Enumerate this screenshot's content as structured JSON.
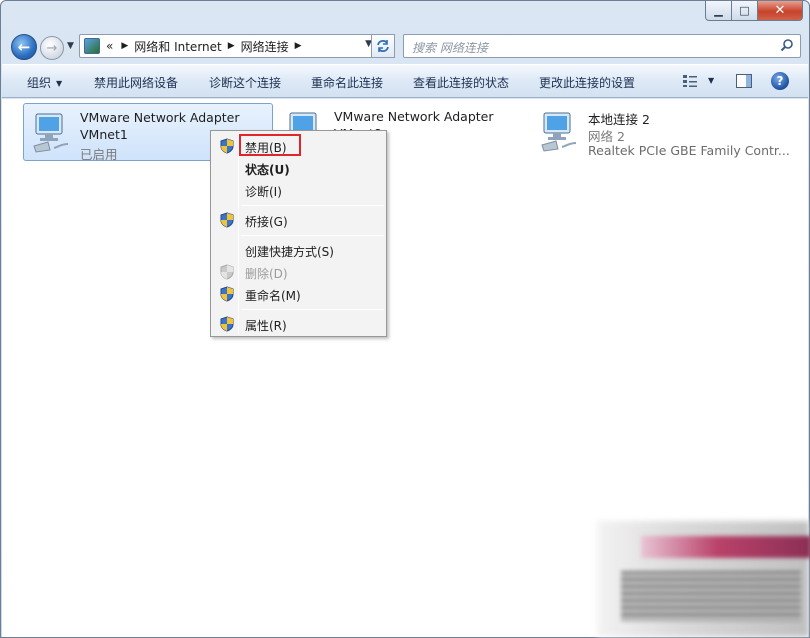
{
  "window": {
    "caption": {
      "minimize": "▁",
      "maximize": "□",
      "close": "✕"
    }
  },
  "navigation": {
    "back_icon": "back-arrow-icon",
    "forward_icon": "forward-arrow-icon",
    "address": {
      "overflow": "«",
      "crumbs": [
        "网络和 Internet",
        "网络连接"
      ]
    },
    "search_placeholder": "搜索 网络连接"
  },
  "command_bar": {
    "items": [
      {
        "label": "组织",
        "has_dropdown": true
      },
      {
        "label": "禁用此网络设备"
      },
      {
        "label": "诊断这个连接"
      },
      {
        "label": "重命名此连接"
      },
      {
        "label": "查看此连接的状态"
      },
      {
        "label": "更改此连接的设置"
      }
    ],
    "help_label": "?"
  },
  "adapters": [
    {
      "name": "VMware Network Adapter",
      "sub": "VMnet1",
      "status": "已启用",
      "selected": true
    },
    {
      "name": "VMware Network Adapter",
      "sub": "VMnet8",
      "status": "",
      "selected": false
    },
    {
      "name": "本地连接 2",
      "sub": "网络  2",
      "status": "Realtek PCIe GBE Family Contr...",
      "selected": false
    }
  ],
  "context_menu": {
    "items": [
      {
        "label": "禁用(B)",
        "shield": true,
        "highlighted": true
      },
      {
        "label": "状态(U)",
        "bold": true
      },
      {
        "label": "诊断(I)"
      },
      {
        "label": "桥接(G)",
        "shield": true
      },
      {
        "label": "创建快捷方式(S)"
      },
      {
        "label": "删除(D)",
        "shield": true,
        "disabled": true
      },
      {
        "label": "重命名(M)",
        "shield": true
      },
      {
        "label": "属性(R)",
        "shield": true
      }
    ]
  },
  "colors": {
    "highlight_border": "#e0262b",
    "selection_fill": "#cfe3fb",
    "accent": "#1c4f9c"
  }
}
